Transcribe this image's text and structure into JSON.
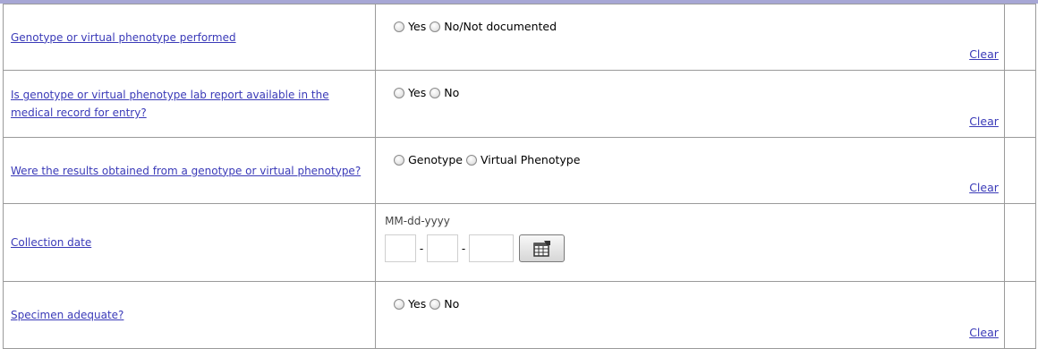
{
  "rows": [
    {
      "question": "Genotype or virtual phenotype performed",
      "options": [
        "Yes",
        "No/Not documented"
      ],
      "clear": "Clear"
    },
    {
      "question": "Is genotype or virtual phenotype lab report available in the medical record for entry?",
      "options": [
        "Yes",
        "No"
      ],
      "clear": "Clear"
    },
    {
      "question": "Were the results obtained from a genotype or virtual phenotype?",
      "options": [
        "Genotype",
        "Virtual Phenotype"
      ],
      "clear": "Clear"
    },
    {
      "question": "Collection date",
      "date_format": "MM-dd-yyyy",
      "date_separator": "-",
      "calendar_icon": "calendar-icon"
    },
    {
      "question": "Specimen adequate?",
      "options": [
        "Yes",
        "No"
      ],
      "clear": "Clear"
    }
  ],
  "colors": {
    "link": "#3a3ab8",
    "header_bar": "#a7a7d5",
    "border": "#9a9a9a"
  }
}
